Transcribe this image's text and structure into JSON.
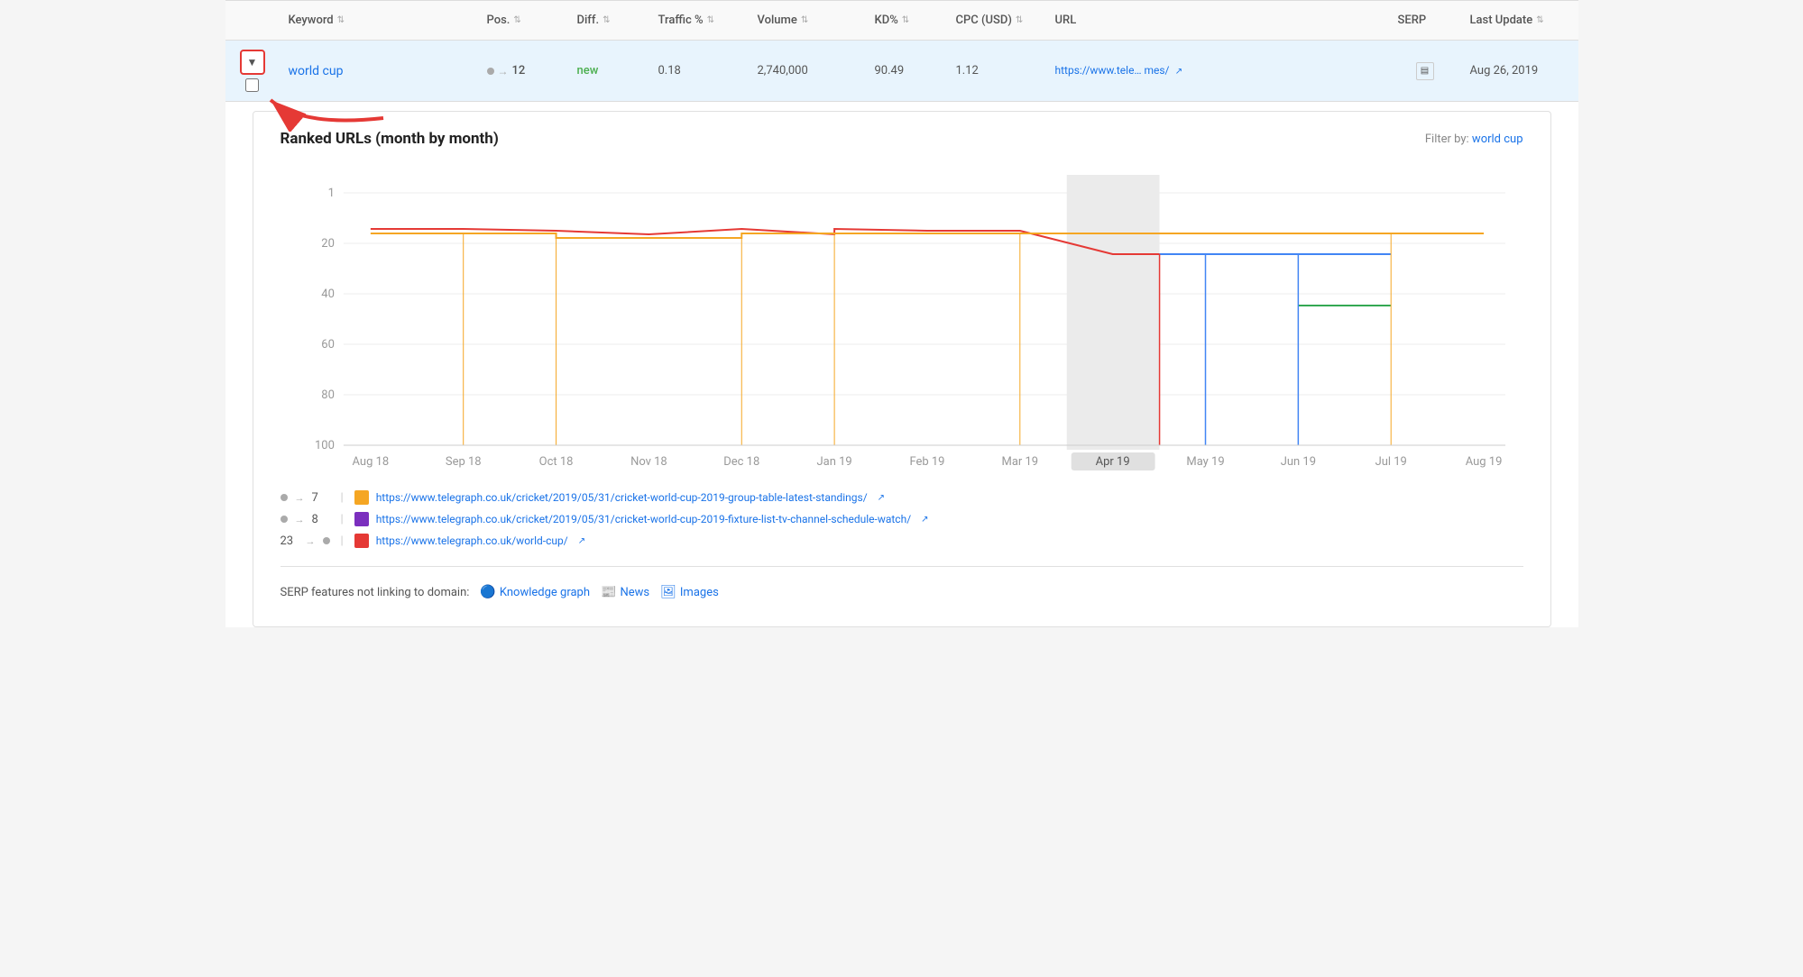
{
  "table": {
    "headers": [
      {
        "label": "",
        "key": "expand"
      },
      {
        "label": "Keyword",
        "key": "keyword",
        "sortable": true
      },
      {
        "label": "Pos.",
        "key": "pos",
        "sortable": true
      },
      {
        "label": "Diff.",
        "key": "diff",
        "sortable": true
      },
      {
        "label": "Traffic %",
        "key": "traffic",
        "sortable": true
      },
      {
        "label": "Volume",
        "key": "volume",
        "sortable": true
      },
      {
        "label": "KD%",
        "key": "kd",
        "sortable": true
      },
      {
        "label": "CPC (USD)",
        "key": "cpc",
        "sortable": true
      },
      {
        "label": "URL",
        "key": "url",
        "sortable": false
      },
      {
        "label": "SERP",
        "key": "serp",
        "sortable": false
      },
      {
        "label": "Last Update",
        "key": "lastUpdate",
        "sortable": true
      }
    ],
    "row": {
      "keyword": "world cup",
      "pos": "12",
      "diff": "new",
      "traffic": "0.18",
      "volume": "2,740,000",
      "kd": "90.49",
      "cpc": "1.12",
      "url": "https://www.tele… mes/",
      "serp_icon": "▤",
      "lastUpdate": "Aug 26, 2019"
    }
  },
  "panel": {
    "title": "Ranked URLs (month by month)",
    "filterLabel": "Filter by:",
    "filterValue": "world cup",
    "chart": {
      "xLabels": [
        "Aug 18",
        "Sep 18",
        "Oct 18",
        "Nov 18",
        "Dec 18",
        "Jan 19",
        "Feb 19",
        "Mar 19",
        "Apr 19",
        "May 19",
        "Jun 19",
        "Jul 19",
        "Aug 19"
      ],
      "yLabels": [
        "1",
        "20",
        "40",
        "60",
        "80",
        "100"
      ],
      "highlightColumn": "Apr 19"
    },
    "urls": [
      {
        "pos": "7",
        "colorBox": "#f5a623",
        "url": "https://www.telegraph.co.uk/cricket/2019/05/31/cricket-world-cup-2019-group-table-latest-standings/",
        "hasExternal": true
      },
      {
        "pos": "8",
        "colorBox": "#7b2fbe",
        "url": "https://www.telegraph.co.uk/cricket/2019/05/31/cricket-world-cup-2019-fixture-list-tv-channel-schedule-watch/",
        "hasExternal": true
      },
      {
        "pos": "23",
        "colorBox": "#e53935",
        "url": "https://www.telegraph.co.uk/world-cup/",
        "hasExternal": true
      }
    ],
    "serpFeatures": {
      "label": "SERP features not linking to domain:",
      "items": [
        {
          "icon": "🔵",
          "label": "Knowledge graph"
        },
        {
          "icon": "📰",
          "label": "News"
        },
        {
          "icon": "🖼",
          "label": "Images"
        }
      ]
    }
  }
}
